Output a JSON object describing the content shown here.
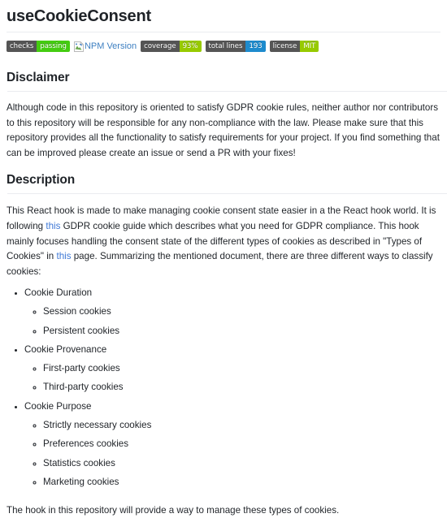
{
  "page": {
    "title": "useCookieConsent"
  },
  "badges": [
    {
      "type": "badge",
      "name": "checks-badge",
      "label": "checks",
      "value": "passing",
      "label_color": "#555555",
      "value_color": "#4c1"
    },
    {
      "type": "broken-image",
      "name": "npm-version-badge",
      "alt_text": "NPM Version",
      "alt_color": "#3d7fc1"
    },
    {
      "type": "badge",
      "name": "coverage-badge",
      "label": "coverage",
      "value": "93%",
      "label_color": "#555555",
      "value_color": "#97ca00"
    },
    {
      "type": "badge",
      "name": "total-lines-badge",
      "label": "total lines",
      "value": "193",
      "label_color": "#555555",
      "value_color": "#1e8bcd"
    },
    {
      "type": "badge",
      "name": "license-badge",
      "label": "license",
      "value": "MIT",
      "label_color": "#555555",
      "value_color": "#97ca00"
    }
  ],
  "sections": {
    "disclaimer": {
      "heading": "Disclaimer",
      "paragraph": "Although code in this repository is oriented to satisfy GDPR cookie rules, neither author nor contributors to this repository will be responsible for any non-compliance with the law. Please make sure that this repository provides all the functionality to satisfy requirements for your project. If you find something that can be improved please create an issue or send a PR with your fixes!"
    },
    "description": {
      "heading": "Description",
      "para_part1": "This React hook is made to make managing cookie consent state easier in a the React hook world. It is following ",
      "link1": "this",
      "para_part2": " GDPR cookie guide which describes what you need for GDPR compliance. This hook mainly focuses handling the consent state of the different types of cookies as described in \"Types of Cookies\" in ",
      "link2": "this",
      "para_part3": " page. Summarizing the mentioned document, there are three different ways to classify cookies:",
      "closing_paragraph": "The hook in this repository will provide a way to manage these types of cookies."
    }
  },
  "cookie_groups": [
    {
      "label": "Cookie Duration",
      "items": [
        "Session cookies",
        "Persistent cookies"
      ]
    },
    {
      "label": "Cookie Provenance",
      "items": [
        "First-party cookies",
        "Third-party cookies"
      ]
    },
    {
      "label": "Cookie Purpose",
      "items": [
        "Strictly necessary cookies",
        "Preferences cookies",
        "Statistics cookies",
        "Marketing cookies"
      ]
    }
  ],
  "colors": {
    "link": "#3f79d6",
    "text": "#1f2328",
    "rule": "#eaecef",
    "badge_gray": "#555555",
    "badge_green": "#4c1",
    "badge_yellowgreen": "#97ca00",
    "badge_blue": "#1e8bcd"
  }
}
